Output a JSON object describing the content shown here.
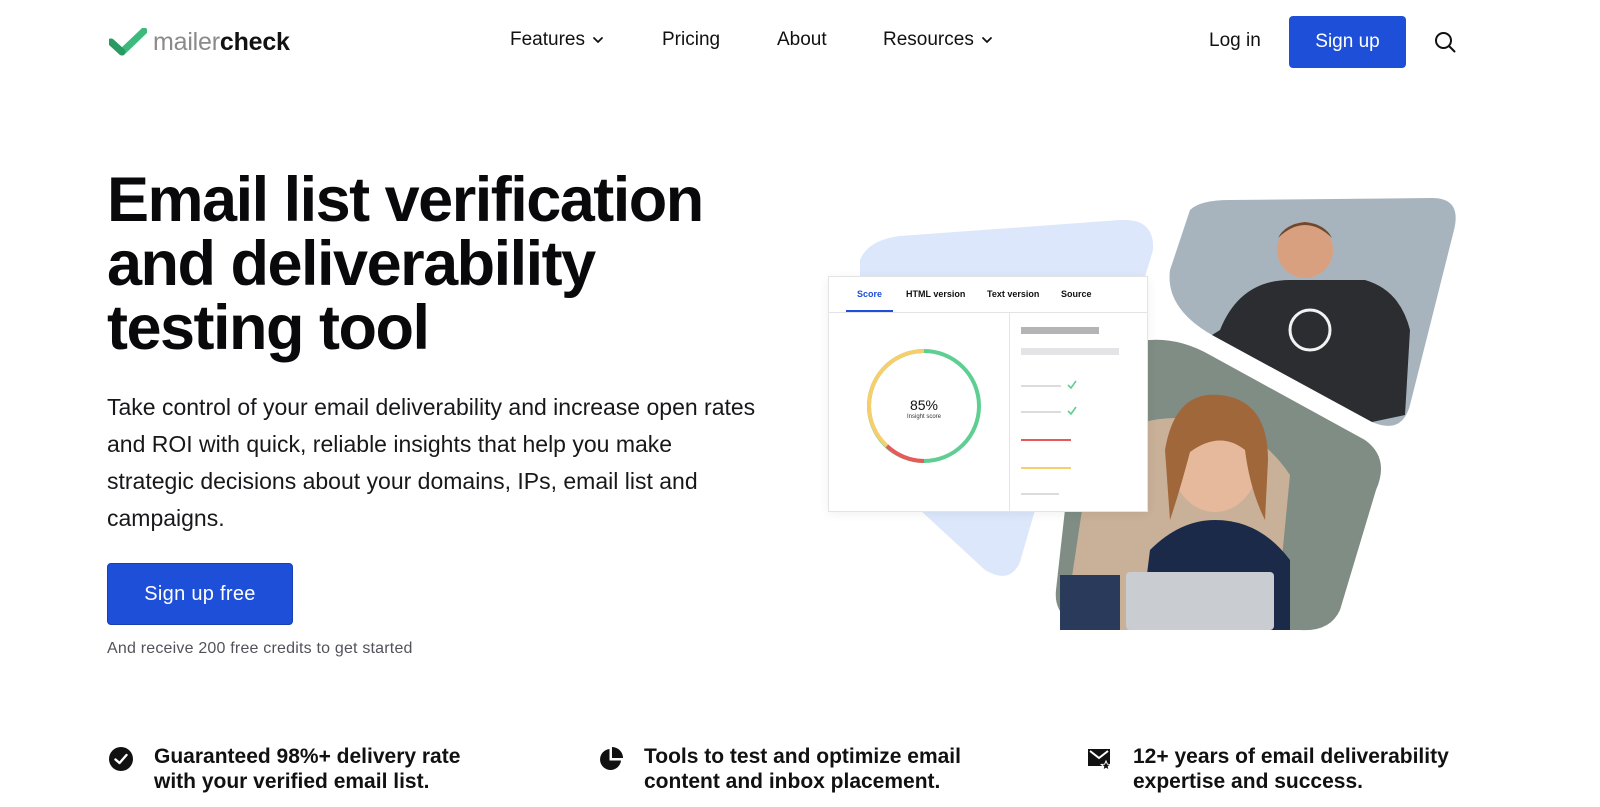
{
  "brand": {
    "name_light": "mailer",
    "name_dark": "check",
    "mark_color": "#3bba7c"
  },
  "nav": {
    "items": [
      {
        "label": "Features",
        "has_dropdown": true
      },
      {
        "label": "Pricing",
        "has_dropdown": false
      },
      {
        "label": "About",
        "has_dropdown": false
      },
      {
        "label": "Resources",
        "has_dropdown": true
      }
    ],
    "login_label": "Log in",
    "signup_label": "Sign up",
    "search_icon": "search-icon"
  },
  "hero": {
    "title_lines": [
      "Email list verification",
      "and deliverability",
      "testing tool"
    ],
    "description": "Take control of your email deliverability and increase open rates and ROI with quick, reliable insights that help you make strategic decisions about your domains, IPs, email list and campaigns.",
    "cta_label": "Sign up free",
    "cta_subtext": "And receive 200 free credits to get started"
  },
  "illustration": {
    "tabs": [
      "Score",
      "HTML version",
      "Text version",
      "Source"
    ],
    "active_tab": "Score",
    "score_value": "85%",
    "score_label": "Insight score",
    "accent_color": "#1e4fd9",
    "gauge_colors": {
      "good": "#5fce93",
      "warn": "#f7ce6e",
      "bad": "#e85a5a"
    },
    "backdrop_color": "#dce7fb"
  },
  "features": [
    {
      "icon": "check-circle-icon",
      "text": "Guaranteed 98%+ delivery rate with your verified email list."
    },
    {
      "icon": "pie-chart-icon",
      "text": "Tools to test and optimize email content and inbox placement."
    },
    {
      "icon": "mail-star-icon",
      "text": "12+ years of email deliverability expertise and success."
    }
  ],
  "colors": {
    "primary": "#1e4fd9",
    "text": "#09090b",
    "muted": "#52525b"
  }
}
